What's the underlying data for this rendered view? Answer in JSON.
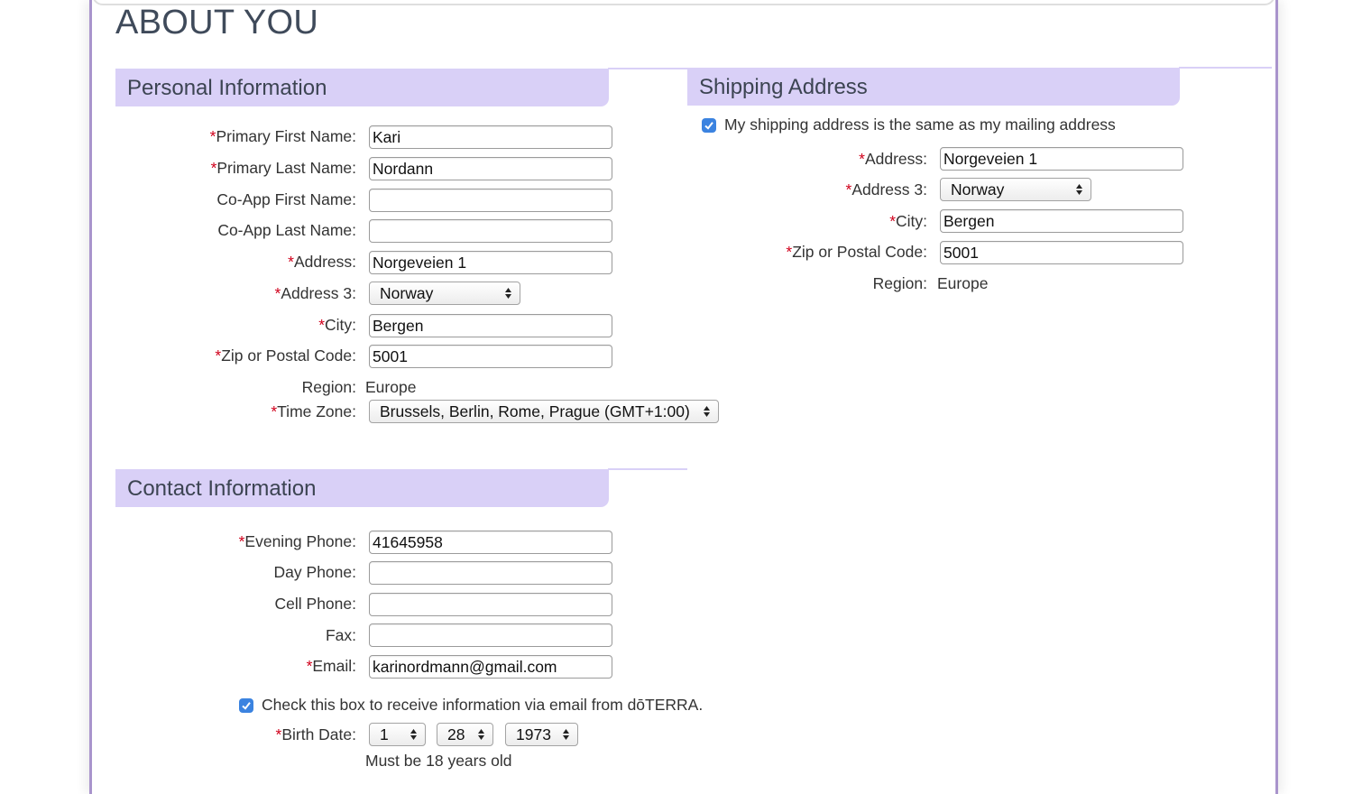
{
  "page": {
    "title": "ABOUT YOU"
  },
  "personal": {
    "header": "Personal Information",
    "fields": {
      "first_name": {
        "label": "Primary First Name:",
        "value": "Kari"
      },
      "last_name": {
        "label": "Primary Last Name:",
        "value": "Nordann"
      },
      "coapp_first": {
        "label": "Co-App First Name:",
        "value": ""
      },
      "coapp_last": {
        "label": "Co-App Last Name:",
        "value": ""
      },
      "address": {
        "label": "Address:",
        "value": "Norgeveien 1"
      },
      "address3": {
        "label": "Address 3:",
        "value": "Norway"
      },
      "city": {
        "label": "City:",
        "value": "Bergen"
      },
      "zip": {
        "label": "Zip or Postal Code:",
        "value": "5001"
      },
      "region": {
        "label": "Region:",
        "value": "Europe"
      },
      "timezone": {
        "label": "Time Zone:",
        "value": "Brussels, Berlin, Rome, Prague (GMT+1:00)"
      }
    }
  },
  "shipping": {
    "header": "Shipping Address",
    "same_as_mailing": {
      "checked": true,
      "label": "My shipping address is the same as my mailing address"
    },
    "fields": {
      "address": {
        "label": "Address:",
        "value": "Norgeveien 1"
      },
      "address3": {
        "label": "Address 3:",
        "value": "Norway"
      },
      "city": {
        "label": "City:",
        "value": "Bergen"
      },
      "zip": {
        "label": "Zip or Postal Code:",
        "value": "5001"
      },
      "region": {
        "label": "Region:",
        "value": "Europe"
      }
    }
  },
  "contact": {
    "header": "Contact Information",
    "fields": {
      "evening_phone": {
        "label": "Evening Phone:",
        "value": "41645958"
      },
      "day_phone": {
        "label": "Day Phone:",
        "value": ""
      },
      "cell_phone": {
        "label": "Cell Phone:",
        "value": ""
      },
      "fax": {
        "label": "Fax:",
        "value": ""
      },
      "email": {
        "label": "Email:",
        "value": "karinordmann@gmail.com"
      }
    },
    "email_optin": {
      "checked": true,
      "label": "Check this box to receive information via email from dōTERRA."
    },
    "birth_date": {
      "label": "Birth Date:",
      "month": "1",
      "day": "28",
      "year": "1973",
      "note": "Must be 18 years old"
    }
  },
  "colors": {
    "header_bg": "#d9d0f7",
    "border": "#a994cc",
    "required": "#d0001b",
    "checkbox": "#3b83e0"
  },
  "icons": {
    "select_arrows": "up-down-arrows-icon",
    "checkbox": "checkmark-icon"
  }
}
